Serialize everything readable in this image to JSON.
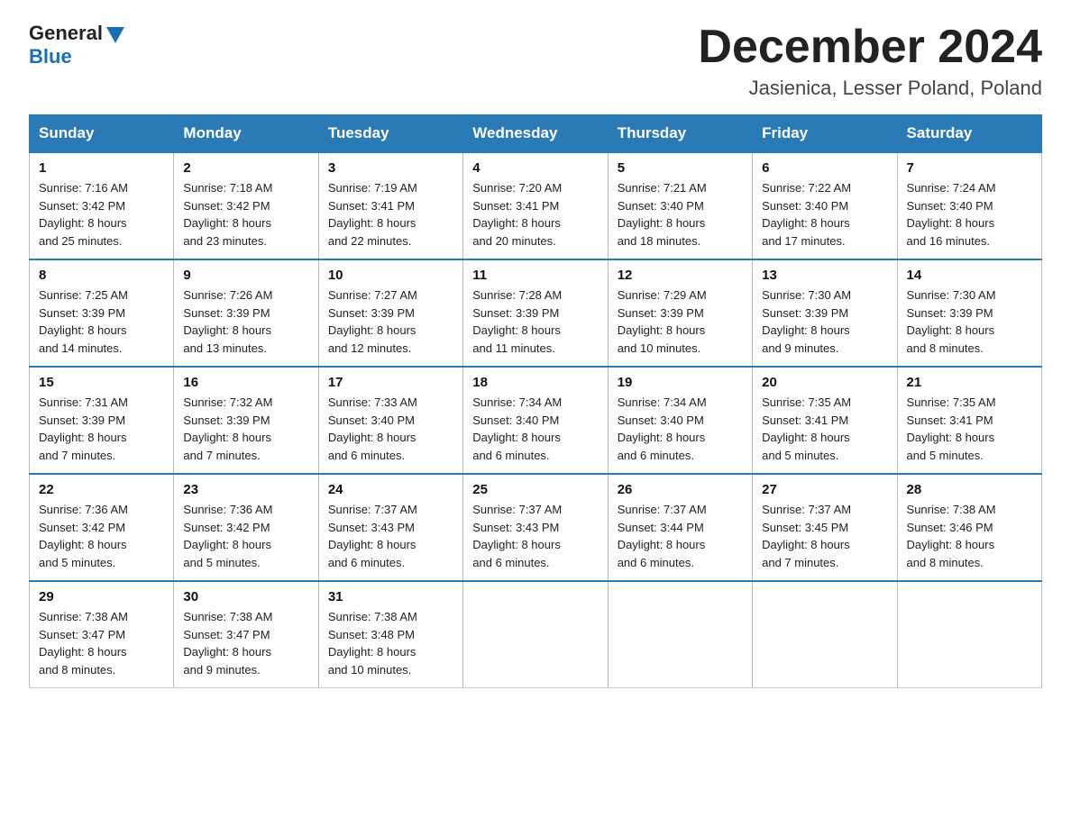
{
  "logo": {
    "general": "General",
    "blue": "Blue"
  },
  "header": {
    "month_year": "December 2024",
    "location": "Jasienica, Lesser Poland, Poland"
  },
  "weekdays": [
    "Sunday",
    "Monday",
    "Tuesday",
    "Wednesday",
    "Thursday",
    "Friday",
    "Saturday"
  ],
  "weeks": [
    [
      {
        "day": "1",
        "sunrise": "7:16 AM",
        "sunset": "3:42 PM",
        "daylight": "8 hours and 25 minutes."
      },
      {
        "day": "2",
        "sunrise": "7:18 AM",
        "sunset": "3:42 PM",
        "daylight": "8 hours and 23 minutes."
      },
      {
        "day": "3",
        "sunrise": "7:19 AM",
        "sunset": "3:41 PM",
        "daylight": "8 hours and 22 minutes."
      },
      {
        "day": "4",
        "sunrise": "7:20 AM",
        "sunset": "3:41 PM",
        "daylight": "8 hours and 20 minutes."
      },
      {
        "day": "5",
        "sunrise": "7:21 AM",
        "sunset": "3:40 PM",
        "daylight": "8 hours and 18 minutes."
      },
      {
        "day": "6",
        "sunrise": "7:22 AM",
        "sunset": "3:40 PM",
        "daylight": "8 hours and 17 minutes."
      },
      {
        "day": "7",
        "sunrise": "7:24 AM",
        "sunset": "3:40 PM",
        "daylight": "8 hours and 16 minutes."
      }
    ],
    [
      {
        "day": "8",
        "sunrise": "7:25 AM",
        "sunset": "3:39 PM",
        "daylight": "8 hours and 14 minutes."
      },
      {
        "day": "9",
        "sunrise": "7:26 AM",
        "sunset": "3:39 PM",
        "daylight": "8 hours and 13 minutes."
      },
      {
        "day": "10",
        "sunrise": "7:27 AM",
        "sunset": "3:39 PM",
        "daylight": "8 hours and 12 minutes."
      },
      {
        "day": "11",
        "sunrise": "7:28 AM",
        "sunset": "3:39 PM",
        "daylight": "8 hours and 11 minutes."
      },
      {
        "day": "12",
        "sunrise": "7:29 AM",
        "sunset": "3:39 PM",
        "daylight": "8 hours and 10 minutes."
      },
      {
        "day": "13",
        "sunrise": "7:30 AM",
        "sunset": "3:39 PM",
        "daylight": "8 hours and 9 minutes."
      },
      {
        "day": "14",
        "sunrise": "7:30 AM",
        "sunset": "3:39 PM",
        "daylight": "8 hours and 8 minutes."
      }
    ],
    [
      {
        "day": "15",
        "sunrise": "7:31 AM",
        "sunset": "3:39 PM",
        "daylight": "8 hours and 7 minutes."
      },
      {
        "day": "16",
        "sunrise": "7:32 AM",
        "sunset": "3:39 PM",
        "daylight": "8 hours and 7 minutes."
      },
      {
        "day": "17",
        "sunrise": "7:33 AM",
        "sunset": "3:40 PM",
        "daylight": "8 hours and 6 minutes."
      },
      {
        "day": "18",
        "sunrise": "7:34 AM",
        "sunset": "3:40 PM",
        "daylight": "8 hours and 6 minutes."
      },
      {
        "day": "19",
        "sunrise": "7:34 AM",
        "sunset": "3:40 PM",
        "daylight": "8 hours and 6 minutes."
      },
      {
        "day": "20",
        "sunrise": "7:35 AM",
        "sunset": "3:41 PM",
        "daylight": "8 hours and 5 minutes."
      },
      {
        "day": "21",
        "sunrise": "7:35 AM",
        "sunset": "3:41 PM",
        "daylight": "8 hours and 5 minutes."
      }
    ],
    [
      {
        "day": "22",
        "sunrise": "7:36 AM",
        "sunset": "3:42 PM",
        "daylight": "8 hours and 5 minutes."
      },
      {
        "day": "23",
        "sunrise": "7:36 AM",
        "sunset": "3:42 PM",
        "daylight": "8 hours and 5 minutes."
      },
      {
        "day": "24",
        "sunrise": "7:37 AM",
        "sunset": "3:43 PM",
        "daylight": "8 hours and 6 minutes."
      },
      {
        "day": "25",
        "sunrise": "7:37 AM",
        "sunset": "3:43 PM",
        "daylight": "8 hours and 6 minutes."
      },
      {
        "day": "26",
        "sunrise": "7:37 AM",
        "sunset": "3:44 PM",
        "daylight": "8 hours and 6 minutes."
      },
      {
        "day": "27",
        "sunrise": "7:37 AM",
        "sunset": "3:45 PM",
        "daylight": "8 hours and 7 minutes."
      },
      {
        "day": "28",
        "sunrise": "7:38 AM",
        "sunset": "3:46 PM",
        "daylight": "8 hours and 8 minutes."
      }
    ],
    [
      {
        "day": "29",
        "sunrise": "7:38 AM",
        "sunset": "3:47 PM",
        "daylight": "8 hours and 8 minutes."
      },
      {
        "day": "30",
        "sunrise": "7:38 AM",
        "sunset": "3:47 PM",
        "daylight": "8 hours and 9 minutes."
      },
      {
        "day": "31",
        "sunrise": "7:38 AM",
        "sunset": "3:48 PM",
        "daylight": "8 hours and 10 minutes."
      },
      null,
      null,
      null,
      null
    ]
  ],
  "labels": {
    "sunrise": "Sunrise:",
    "sunset": "Sunset:",
    "daylight": "Daylight:"
  }
}
